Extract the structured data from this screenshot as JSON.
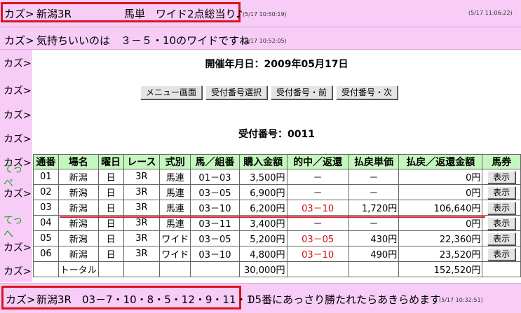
{
  "chat": {
    "top": {
      "who": "カズ>",
      "msg": "新潟3R　　　　　馬単　ワイド2点総当り♪",
      "time": "(5/17 10:50:19)",
      "right_time": "(5/17 11:06:22)"
    },
    "second": {
      "who": "カズ>",
      "msg": "気持ちいいのは　３－５・10のワイドですね",
      "time": "(5/17 10:52:05)"
    },
    "left_column": [
      "カズ>",
      "カズ>",
      "カズ>",
      "カズ>",
      "カズ>",
      "てっぺ",
      "カズ>",
      "てっへ",
      "カズ>",
      "カズ>"
    ],
    "bottom": {
      "who": "カズ>",
      "msg": "新潟3R　03－7・10・8・5・12・9・11・1",
      "msg2": "05番にあっさり勝たれたらあきらめます",
      "time": "(5/17 10:32:51)"
    }
  },
  "page": {
    "date_title": "開催年月日：2009年05月17日",
    "receipt_title": "受付番号：0011",
    "buttons": [
      "メニュー画面",
      "受付番号選択",
      "受付番号・前",
      "受付番号・次"
    ]
  },
  "table": {
    "headers": [
      "通番",
      "場名",
      "曜日",
      "レース",
      "式別",
      "馬／組番",
      "購入金額",
      "的中／返還",
      "払戻単価",
      "払戻／返還金額",
      "馬券"
    ],
    "rows": [
      [
        "01",
        "新潟",
        "日",
        "3R",
        "馬連",
        "01－03",
        "3,500円",
        "－",
        "－",
        "0円",
        "表示"
      ],
      [
        "02",
        "新潟",
        "日",
        "3R",
        "馬連",
        "03－05",
        "6,900円",
        "－",
        "－",
        "0円",
        "表示"
      ],
      [
        "03",
        "新潟",
        "日",
        "3R",
        "馬連",
        "03－10",
        "6,200円",
        "03－10",
        "1,720円",
        "106,640円",
        "表示"
      ],
      [
        "04",
        "新潟",
        "日",
        "3R",
        "馬連",
        "03－11",
        "3,400円",
        "－",
        "－",
        "0円",
        "表示"
      ],
      [
        "05",
        "新潟",
        "日",
        "3R",
        "ワイド",
        "03－05",
        "5,200円",
        "03－05",
        "430円",
        "22,360円",
        "表示"
      ],
      [
        "06",
        "新潟",
        "日",
        "3R",
        "ワイド",
        "03－10",
        "4,800円",
        "03－10",
        "490円",
        "23,520円",
        "表示"
      ]
    ],
    "total": {
      "label": "トータル",
      "purchase": "30,000円",
      "payout": "152,520円"
    }
  },
  "colors": {
    "accent_red": "#d9151e",
    "chat_pink": "#f7ccf7",
    "header_green": "#c4f7bd",
    "hit_red": "#d01010"
  }
}
